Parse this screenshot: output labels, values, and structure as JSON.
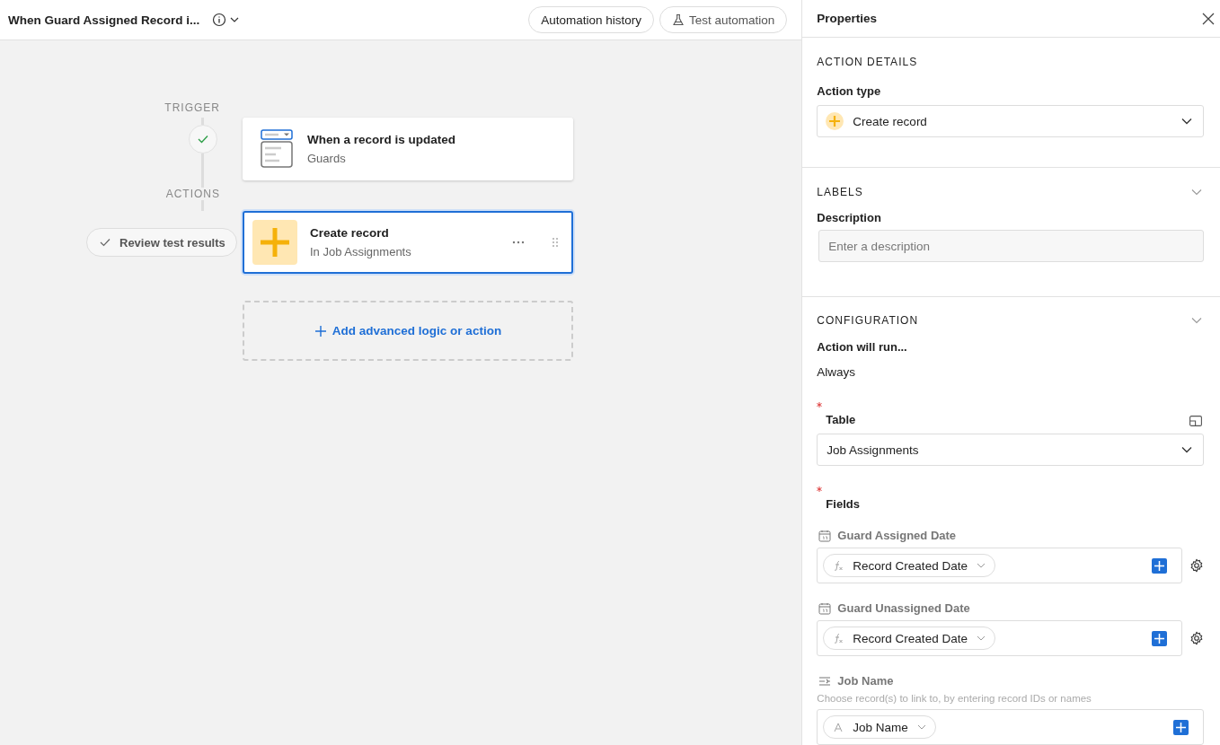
{
  "header": {
    "title": "When Guard Assigned Record i...",
    "buttons": [
      {
        "label": "Automation history",
        "kind": "plain"
      },
      {
        "label": "Test automation",
        "kind": "flask"
      }
    ]
  },
  "canvas": {
    "trigger_label": "TRIGGER",
    "trigger": {
      "title": "When a record is updated",
      "subtitle": "Guards",
      "selected": false,
      "tested": true
    },
    "actions_label": "ACTIONS",
    "review_button": "Review test results",
    "actions": [
      {
        "title": "Create record",
        "subtitle": "In Job Assignments",
        "selected": true
      }
    ],
    "add_button": "Add advanced logic or action"
  },
  "properties": {
    "title": "Properties",
    "action_details": {
      "heading": "ACTION DETAILS",
      "label": "Action type",
      "value": "Create record"
    },
    "labels": {
      "heading": "LABELS",
      "expanded": true,
      "label": "Description",
      "placeholder": "Enter a description"
    },
    "configuration": {
      "heading": "CONFIGURATION",
      "expanded": true,
      "run_label": "Action will run...",
      "run_value": "Always",
      "table_required": true,
      "table_label": "Table",
      "table_value": "Job Assignments",
      "fields_required": true,
      "fields_label": "Fields",
      "fields": [
        {
          "kind": "date",
          "name": "Guard Assigned Date",
          "token": {
            "kind": "formula",
            "label": "Record Created Date"
          },
          "settings": true
        },
        {
          "kind": "date",
          "name": "Guard Unassigned Date",
          "token": {
            "kind": "formula",
            "label": "Record Created Date"
          },
          "settings": true
        },
        {
          "kind": "link",
          "name": "Job Name",
          "hint": "Choose record(s) to link to, by entering record IDs or names",
          "token": {
            "kind": "text",
            "label": "Job Name"
          },
          "settings": false
        }
      ]
    }
  }
}
